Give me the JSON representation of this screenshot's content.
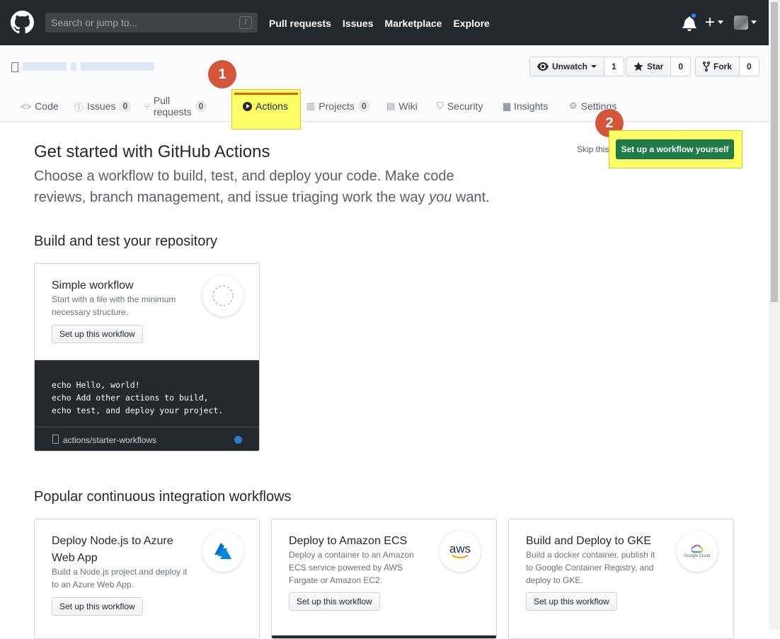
{
  "header": {
    "search_placeholder": "Search or jump to...",
    "slash_key": "/",
    "nav": [
      "Pull requests",
      "Issues",
      "Marketplace",
      "Explore"
    ],
    "plus": "+"
  },
  "repo": {
    "watch": {
      "label": "Unwatch",
      "count": "1"
    },
    "star": {
      "label": "Star",
      "count": "0"
    },
    "fork": {
      "label": "Fork",
      "count": "0"
    },
    "tabs": [
      {
        "label": "Code",
        "icon": "code-icon"
      },
      {
        "label": "Issues",
        "badge": "0",
        "icon": "issue-icon"
      },
      {
        "label": "Pull requests",
        "badge": "0",
        "icon": "pull-request-icon"
      },
      {
        "label": "Actions",
        "icon": "play-icon"
      },
      {
        "label": "Projects",
        "badge": "0",
        "icon": "project-icon"
      },
      {
        "label": "Wiki",
        "icon": "book-icon"
      },
      {
        "label": "Security",
        "icon": "shield-icon"
      },
      {
        "label": "Insights",
        "icon": "graph-icon"
      },
      {
        "label": "Settings",
        "icon": "gear-icon"
      }
    ]
  },
  "markers": [
    "1",
    "2"
  ],
  "main": {
    "title": "Get started with GitHub Actions",
    "lead_before": "Choose a workflow to build, test, and deploy your code. Make code reviews, branch management, and issue triaging work the way ",
    "lead_em": "you",
    "lead_after": " want.",
    "skip": "Skip this:",
    "setup_button": "Set up a workflow yourself",
    "section1": "Build and test your repository",
    "simple": {
      "title": "Simple workflow",
      "desc": "Start with a file with the minimum necessary structure.",
      "button": "Set up this workflow",
      "code": [
        "echo Hello, world!",
        "echo Add other actions to build,",
        "echo test, and deploy your project."
      ],
      "footer": "actions/starter-workflows"
    },
    "section2": "Popular continuous integration workflows",
    "cards": [
      {
        "title": "Deploy Node.js to Azure Web App",
        "desc": "Build a Node.js project and deploy it to an Azure Web App.",
        "button": "Set up this workflow",
        "logo": "azure-logo-icon"
      },
      {
        "title": "Deploy to Amazon ECS",
        "desc": "Deploy a container to an Amazon ECS service powered by AWS Fargate or Amazon EC2.",
        "button": "Set up this workflow",
        "logo": "aws-logo-icon",
        "logo_text": "aws"
      },
      {
        "title": "Build and Deploy to GKE",
        "desc": "Build a docker container, publish it to Google Container Registry, and deploy to GKE.",
        "button": "Set up this workflow",
        "logo": "google-cloud-logo-icon",
        "logo_text": "Google Cloud"
      }
    ]
  }
}
